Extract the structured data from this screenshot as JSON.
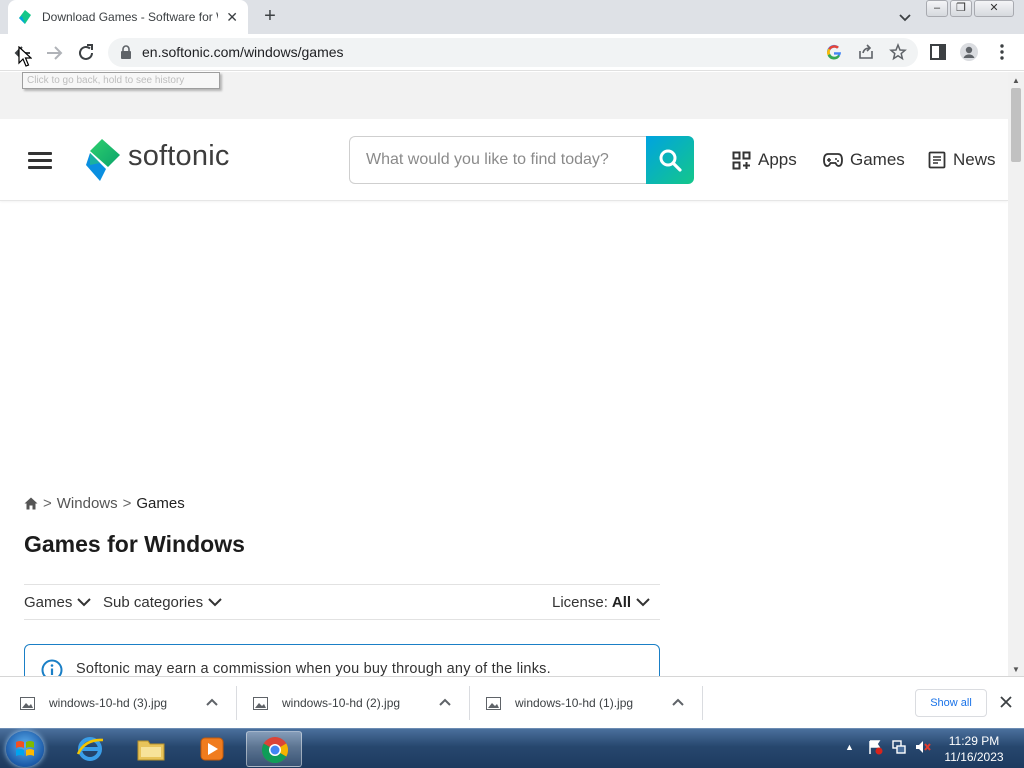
{
  "browser": {
    "tab_title": "Download Games - Software for Windows",
    "url": "en.softonic.com/windows/games",
    "tooltip": "Click to go back, hold to see history"
  },
  "header": {
    "logo_text": "softonic",
    "search_placeholder": "What would you like to find today?",
    "nav": [
      {
        "label": "Apps",
        "icon": "apps-grid-icon"
      },
      {
        "label": "Games",
        "icon": "gamepad-icon"
      },
      {
        "label": "News",
        "icon": "news-icon"
      }
    ]
  },
  "breadcrumb": {
    "items": [
      "Windows",
      "Games"
    ],
    "separator": ">"
  },
  "page": {
    "title": "Games for Windows",
    "filters": {
      "games_label": "Games",
      "subcategories_label": "Sub categories",
      "license_label": "License:",
      "license_value": "All"
    },
    "notice": "Softonic may earn a commission when you buy through any of the links."
  },
  "downloads": {
    "items": [
      "windows-10-hd (3).jpg",
      "windows-10-hd (2).jpg",
      "windows-10-hd (1).jpg"
    ],
    "show_all": "Show all"
  },
  "taskbar": {
    "time": "11:29 PM",
    "date": "11/16/2023"
  },
  "colors": {
    "brand_gradient_start": "#00a3e0",
    "brand_gradient_end": "#14c78a",
    "notice_border": "#1a7fc6",
    "link_blue": "#1a73e8"
  }
}
